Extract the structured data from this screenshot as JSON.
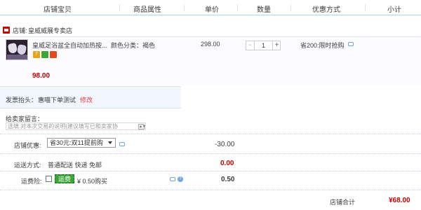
{
  "header": {
    "columns": [
      "店铺宝贝",
      "商品属性",
      "单价",
      "数量",
      "优惠方式",
      "小计"
    ]
  },
  "shop": {
    "label": "店铺:",
    "name": "皇威威展专卖店"
  },
  "item": {
    "title": "皇威足浴盆全自动加热按...",
    "attr": "颜色分类：褐色",
    "unit_price": "298.00",
    "quantity": "1",
    "qty_minus": "-",
    "qty_plus": "+",
    "promo": "省200:限时抢购",
    "subtotal": "98.00",
    "badges": [
      {
        "icon": "seven-day-return-icon",
        "text": "7",
        "color": "#e8a317"
      },
      {
        "icon": "guarantee-icon",
        "text": "",
        "color": "#3aa63a"
      },
      {
        "icon": "credit-card-icon",
        "text": "",
        "color": "#e24c1c"
      }
    ]
  },
  "invoice": {
    "label": "发票抬头：",
    "value": "惠喵下单测试",
    "edit": "修改"
  },
  "message": {
    "label": "给卖家留言：",
    "placeholder": "选填:对本次交易的说明(建议填写已和卖家协"
  },
  "discount": {
    "label": "店铺优惠:",
    "selected": "省30元:双11提前购",
    "amount": "-30.00"
  },
  "shipping": {
    "label": "运送方式:",
    "method": "普通配送 快递 免邮",
    "amount": "0.00"
  },
  "insurance": {
    "label": "运费险:",
    "badge": "运费险",
    "price_text": "¥ 0.50购买",
    "amount": "0.50"
  },
  "total": {
    "label": "店铺合计",
    "value": "¥68.00"
  },
  "colors": {
    "accent_red": "#c40000",
    "header_line": "#b2d1ff",
    "edit_link": "#e4393c"
  }
}
